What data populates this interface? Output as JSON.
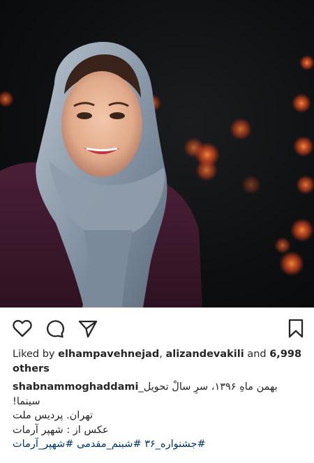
{
  "post": {
    "likes": {
      "prefix": "Liked by ",
      "user1": "elhampavehnejad",
      "separator": ", ",
      "user2": "alizandevakili",
      "and_text": " and ",
      "others_count": "6,998",
      "others_label": "others"
    },
    "caption": {
      "username": "shabnammoghaddami",
      "line1_text": "بهمن ماهِ ۱۳۹۶، سرِ سالْ تحویل_",
      "line2_text": "سینما!",
      "line3_text": "تهران. پردیس ملت",
      "line4_text": "عکس از : شهپر آرمات",
      "hashtags_line": "#جشنواره_۳۶ #شبنم_مقدمی #شهپر_آرمات"
    }
  },
  "icons": {
    "like": "heart-icon",
    "comment": "comment-icon",
    "share": "paper-plane-icon",
    "save": "bookmark-icon"
  },
  "colors": {
    "text": "#262626",
    "hashtag": "#003569",
    "photo_background": "#0d0f10",
    "bokeh": "#ff6a2a"
  }
}
